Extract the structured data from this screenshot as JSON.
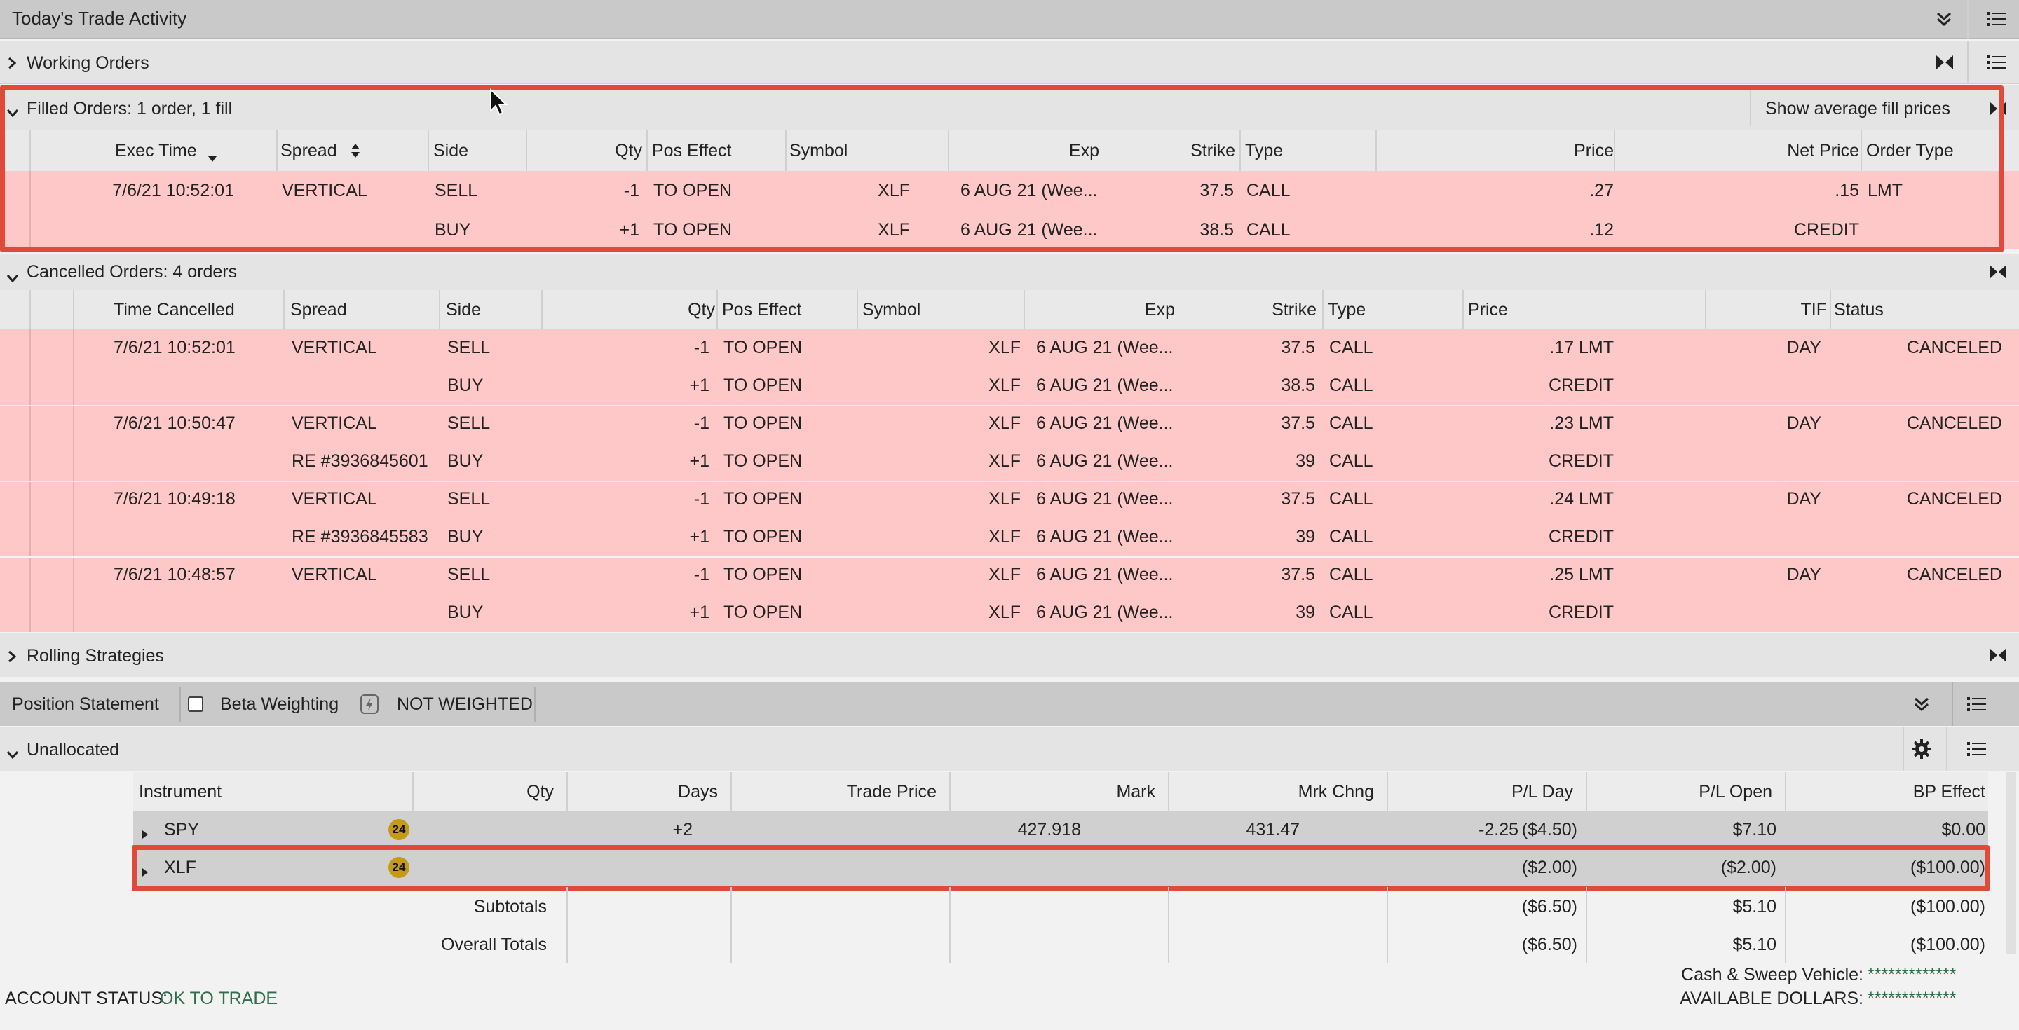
{
  "title_bar": {
    "title": "Today's Trade Activity"
  },
  "working_orders": {
    "label": "Working Orders"
  },
  "filled_orders": {
    "label": "Filled Orders: 1 order, 1 fill",
    "show_avg_button": "Show average fill prices",
    "columns": [
      "Exec Time",
      "Spread",
      "Side",
      "Qty",
      "Pos Effect",
      "Symbol",
      "Exp",
      "Strike",
      "Type",
      "Price",
      "Net Price",
      "Order Type"
    ],
    "rows": [
      [
        "7/6/21 10:52:01",
        "VERTICAL",
        "SELL",
        "-1",
        "TO OPEN",
        "XLF",
        "6 AUG 21 (Wee...",
        "37.5",
        "CALL",
        ".27",
        ".15",
        "LMT"
      ],
      [
        "",
        "",
        "BUY",
        "+1",
        "TO OPEN",
        "XLF",
        "6 AUG 21 (Wee...",
        "38.5",
        "CALL",
        ".12",
        "CREDIT",
        ""
      ]
    ]
  },
  "cancelled_orders": {
    "label": "Cancelled Orders: 4 orders",
    "columns": [
      "Time Cancelled",
      "Spread",
      "Side",
      "Qty",
      "Pos Effect",
      "Symbol",
      "Exp",
      "Strike",
      "Type",
      "Price",
      "TIF",
      "Status"
    ],
    "rows": [
      [
        "7/6/21 10:52:01",
        "VERTICAL",
        "SELL",
        "-1",
        "TO OPEN",
        "XLF",
        "6 AUG 21 (Wee...",
        "37.5",
        "CALL",
        ".17 LMT",
        "DAY",
        "CANCELED"
      ],
      [
        "",
        "",
        "BUY",
        "+1",
        "TO OPEN",
        "XLF",
        "6 AUG 21 (Wee...",
        "38.5",
        "CALL",
        "CREDIT",
        "",
        ""
      ],
      [
        "7/6/21 10:50:47",
        "VERTICAL",
        "SELL",
        "-1",
        "TO OPEN",
        "XLF",
        "6 AUG 21 (Wee...",
        "37.5",
        "CALL",
        ".23 LMT",
        "DAY",
        "CANCELED"
      ],
      [
        "",
        "RE #3936845601",
        "BUY",
        "+1",
        "TO OPEN",
        "XLF",
        "6 AUG 21 (Wee...",
        "39",
        "CALL",
        "CREDIT",
        "",
        ""
      ],
      [
        "7/6/21 10:49:18",
        "VERTICAL",
        "SELL",
        "-1",
        "TO OPEN",
        "XLF",
        "6 AUG 21 (Wee...",
        "37.5",
        "CALL",
        ".24 LMT",
        "DAY",
        "CANCELED"
      ],
      [
        "",
        "RE #3936845583",
        "BUY",
        "+1",
        "TO OPEN",
        "XLF",
        "6 AUG 21 (Wee...",
        "39",
        "CALL",
        "CREDIT",
        "",
        ""
      ],
      [
        "7/6/21 10:48:57",
        "VERTICAL",
        "SELL",
        "-1",
        "TO OPEN",
        "XLF",
        "6 AUG 21 (Wee...",
        "37.5",
        "CALL",
        ".25 LMT",
        "DAY",
        "CANCELED"
      ],
      [
        "",
        "",
        "BUY",
        "+1",
        "TO OPEN",
        "XLF",
        "6 AUG 21 (Wee...",
        "39",
        "CALL",
        "CREDIT",
        "",
        ""
      ]
    ]
  },
  "rolling": {
    "label": "Rolling Strategies"
  },
  "position_statement": {
    "label": "Position Statement",
    "beta_label": "Beta Weighting",
    "weight_status": "NOT WEIGHTED"
  },
  "unallocated": {
    "label": "Unallocated",
    "columns": [
      "Instrument",
      "Qty",
      "Days",
      "Trade Price",
      "Mark",
      "Mrk Chng",
      "P/L Day",
      "P/L Open",
      "BP Effect"
    ],
    "rows": [
      {
        "symbol": "SPY",
        "badge": "24",
        "qty": "+2",
        "days": "",
        "trade_price": "427.918",
        "mark": "431.47",
        "mrk_chng": "-2.25",
        "pl_day": "($4.50)",
        "pl_open": "$7.10",
        "bp_effect": "$0.00"
      },
      {
        "symbol": "XLF",
        "badge": "24",
        "qty": "",
        "days": "",
        "trade_price": "",
        "mark": "",
        "mrk_chng": "",
        "pl_day": "($2.00)",
        "pl_open": "($2.00)",
        "bp_effect": "($100.00)"
      }
    ],
    "subtotals": {
      "label": "Subtotals",
      "pl_day": "($6.50)",
      "pl_open": "$5.10",
      "bp_effect": "($100.00)"
    },
    "overall": {
      "label": "Overall Totals",
      "pl_day": "($6.50)",
      "pl_open": "$5.10",
      "bp_effect": "($100.00)"
    }
  },
  "footer": {
    "account_status_label": "ACCOUNT STATUS:",
    "account_status_value": "OK TO TRADE",
    "cash_label": "Cash & Sweep Vehicle:",
    "cash_value": "*************",
    "available_label": "AVAILABLE DOLLARS:",
    "available_value": "*************"
  },
  "icons": [
    "chevron-right-icon",
    "chevron-down-icon",
    "collapse-toggle-icon",
    "menu-list-icon",
    "sort-down-icon",
    "sort-updown-icon",
    "gear-icon",
    "lightning-icon",
    "mouse-cursor-icon"
  ],
  "colors": {
    "row_highlight": "#ffc8c8",
    "annotation_red": "#e04a3a",
    "status_ok": "#2f6e4b",
    "badge": "#c59a16"
  }
}
